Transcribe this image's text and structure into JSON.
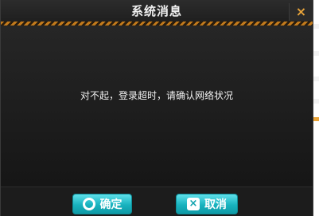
{
  "dialog": {
    "title": "系统消息",
    "message": "对不起，登录超时，请确认网络状况",
    "close_icon": "×",
    "buttons": {
      "ok_label": "确定",
      "cancel_label": "取消",
      "cancel_icon": "×"
    }
  },
  "colors": {
    "accent": "#e8a43a",
    "button": "#18b2be"
  }
}
